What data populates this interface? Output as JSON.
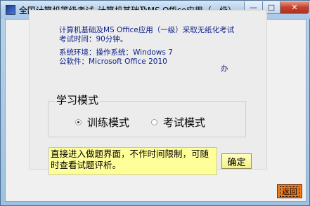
{
  "window": {
    "title": "全国计算机等级考试_计算机基础及MS Office应用（一级）",
    "controls": {
      "minimize": "—",
      "maximize": "□",
      "close": "✕"
    }
  },
  "info": {
    "line1": "计算机基础及MS Office应用（一级）采取无纸化考试",
    "line2": "考试时间：90分钟。",
    "line3": "系统环境：操作系统：Windows 7",
    "line3_right": "办",
    "line4": "公软件：Microsoft Office 2010"
  },
  "mode_group": {
    "legend": "学习模式",
    "options": [
      {
        "label": "训练模式",
        "selected": true
      },
      {
        "label": "考试模式",
        "selected": false
      }
    ]
  },
  "hint": "直接进入做题界面，不作时间限制，可随时查看试题评析。",
  "buttons": {
    "confirm": "确定",
    "back": "返回"
  }
}
